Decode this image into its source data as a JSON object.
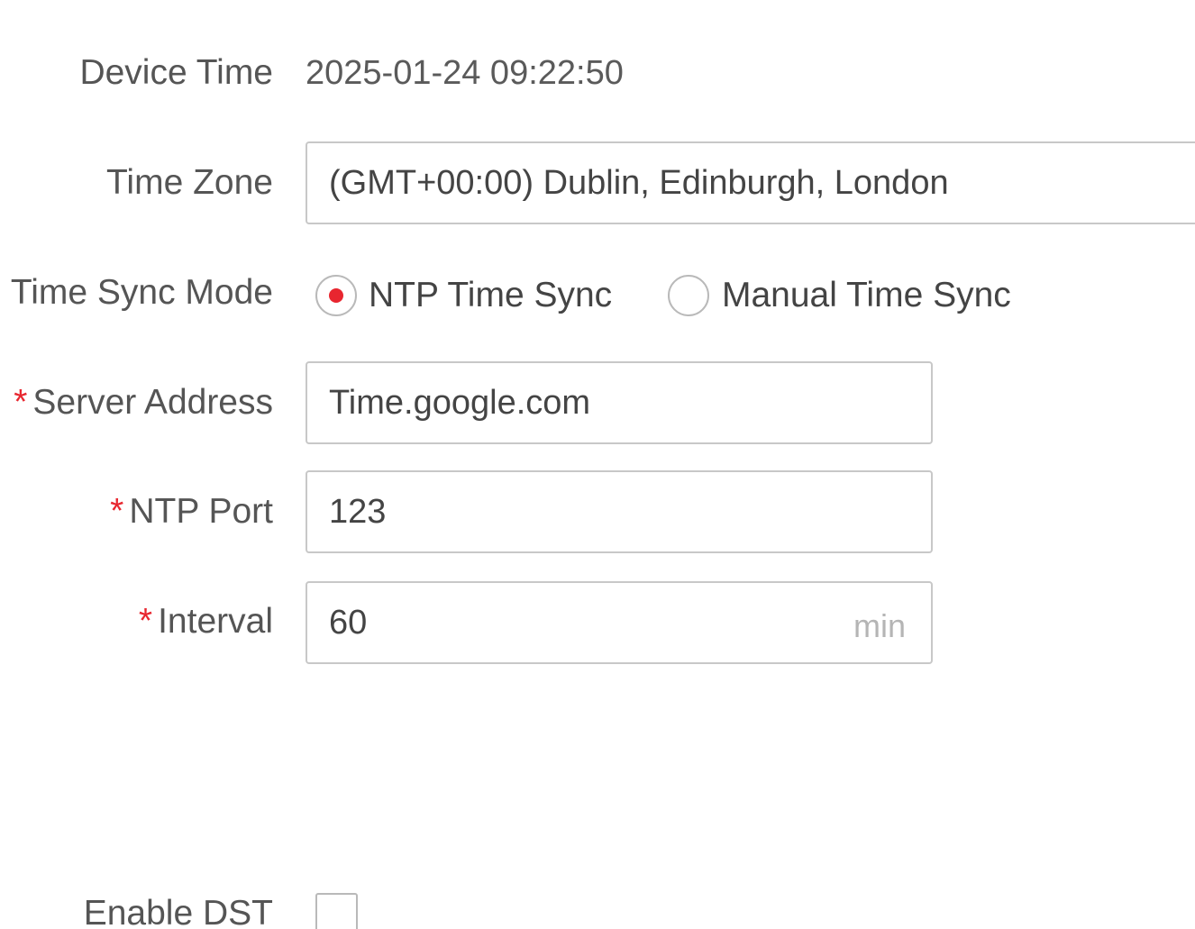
{
  "form": {
    "device_time": {
      "label": "Device Time",
      "value": "2025-01-24 09:22:50"
    },
    "time_zone": {
      "label": "Time Zone",
      "value": "(GMT+00:00) Dublin, Edinburgh, London"
    },
    "time_sync_mode": {
      "label": "Time Sync Mode",
      "options": [
        {
          "label": "NTP Time Sync",
          "selected": true
        },
        {
          "label": "Manual Time Sync",
          "selected": false
        }
      ]
    },
    "server_address": {
      "required_mark": "*",
      "label": "Server Address",
      "value": "Time.google.com"
    },
    "ntp_port": {
      "required_mark": "*",
      "label": "NTP Port",
      "value": "123"
    },
    "interval": {
      "required_mark": "*",
      "label": "Interval",
      "value": "60",
      "unit": "min"
    },
    "enable_dst": {
      "label": "Enable DST",
      "checked": false
    }
  },
  "colors": {
    "accent": "#e8262f",
    "border": "#c8c8c8",
    "label_text": "#555555",
    "placeholder": "#b5b5b5"
  }
}
